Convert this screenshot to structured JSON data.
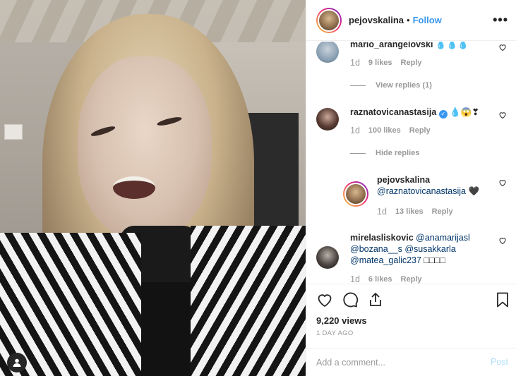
{
  "header": {
    "username": "pejovskalina",
    "separator": "•",
    "follow_label": "Follow",
    "more_icon": "more-horizontal-icon",
    "more_label": "•••"
  },
  "comments": [
    {
      "username": "mario_arangelovski",
      "text": "💧💧💧",
      "time": "1d",
      "likes": "9 likes",
      "reply": "Reply",
      "view_replies": "View replies (1)"
    },
    {
      "username": "raznatovicanastasija",
      "verified_mark": "✓",
      "text": "💧😱❣",
      "time": "1d",
      "likes": "100 likes",
      "reply": "Reply",
      "hide_replies": "Hide replies"
    },
    {
      "username": "pejovskalina",
      "mention": "@raznatovicanastasija",
      "text": "🖤",
      "time": "1d",
      "likes": "13 likes",
      "reply": "Reply"
    },
    {
      "username": "mirelasliskovic",
      "mentions": [
        "@anamarijasl",
        "@bozana__s",
        "@susakkarla",
        "@matea_galic237"
      ],
      "text": "□□□□",
      "time": "1d",
      "likes": "6 likes",
      "reply": "Reply"
    }
  ],
  "actions": {
    "like_icon": "heart-icon",
    "comment_icon": "comment-icon",
    "share_icon": "share-icon",
    "save_icon": "bookmark-icon",
    "views": "9,220 views",
    "ago": "1 DAY AGO"
  },
  "add_comment": {
    "placeholder": "Add a comment...",
    "post_label": "Post"
  },
  "media": {
    "tag_icon": "user-tag-icon"
  },
  "colors": {
    "accent": "#3897f0",
    "text": "#262626",
    "muted": "#999999",
    "post_disabled": "#b2dffc"
  }
}
